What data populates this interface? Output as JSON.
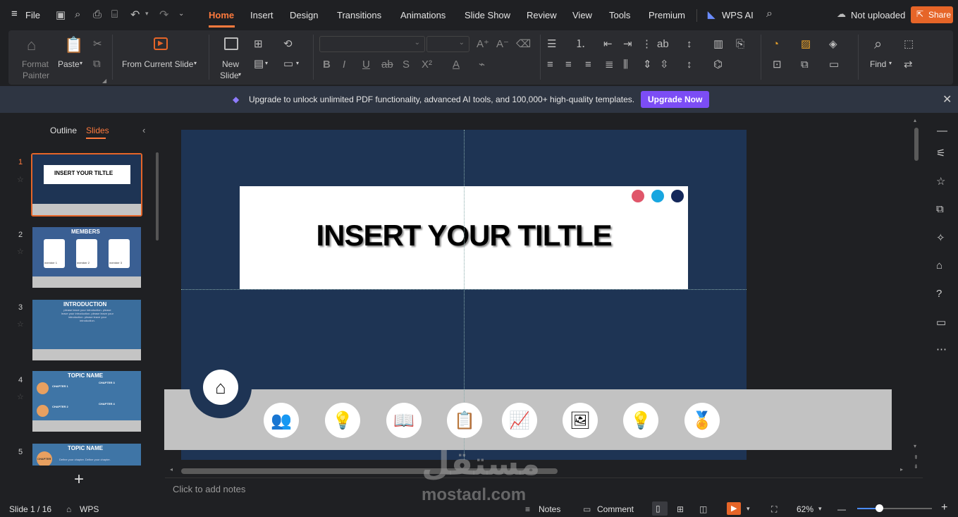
{
  "menu": {
    "file": "File",
    "tabs": [
      "Home",
      "Insert",
      "Design",
      "Transitions",
      "Animations",
      "Slide Show",
      "Review",
      "View",
      "Tools",
      "Premium"
    ],
    "active_tab": "Home",
    "wps_ai": "WPS AI",
    "cloud_status": "Not uploaded",
    "share": "Share"
  },
  "ribbon": {
    "format_painter": [
      "Format",
      "Painter"
    ],
    "paste": "Paste",
    "from_current_slide": "From Current Slide",
    "new_slide": [
      "New",
      "Slide"
    ],
    "find": "Find"
  },
  "banner": {
    "text": "Upgrade to unlock unlimited PDF functionality, advanced AI tools, and 100,000+ high-quality templates.",
    "button": "Upgrade Now"
  },
  "panel": {
    "tab_outline": "Outline",
    "tab_slides": "Slides",
    "slides": [
      {
        "num": "1",
        "title": "INSERT YOUR TILTLE"
      },
      {
        "num": "2",
        "title": "MEMBERS",
        "members": [
          "member 1",
          "member 2",
          "member 3"
        ]
      },
      {
        "num": "3",
        "title": "INTRODUCTION",
        "body": "please leave your introduction. please leave your introduction. please leave your introduction. please leave your introduction."
      },
      {
        "num": "4",
        "title": "TOPIC NAME",
        "chapters": [
          "CHAPTER 1",
          "CHAPTER 3",
          "CHAPTER 2",
          "CHAPTER 4"
        ],
        "subtitle": "SUBTITLE"
      },
      {
        "num": "5",
        "title": "TOPIC NAME",
        "chapter": "CHAPTER",
        "body": "Define your chapter. Define your chapter."
      }
    ]
  },
  "slide": {
    "title": "INSERT YOUR TILTLE",
    "dot_colors": [
      "#e0566a",
      "#18a6e0",
      "#14285a"
    ],
    "icons": [
      "home-icon",
      "team-icon",
      "idea-hand-icon",
      "book-icon",
      "clipboard-icon",
      "growth-chart-icon",
      "image-icon",
      "lightbulb-puzzle-icon",
      "award-icon"
    ]
  },
  "notes_placeholder": "Click to add notes",
  "watermark": {
    "arabic": "مستقل",
    "latin": "mostaql.com"
  },
  "status": {
    "slide_counter": "Slide 1 / 16",
    "theme": "WPS",
    "notes": "Notes",
    "comment": "Comment",
    "zoom": "62%"
  }
}
